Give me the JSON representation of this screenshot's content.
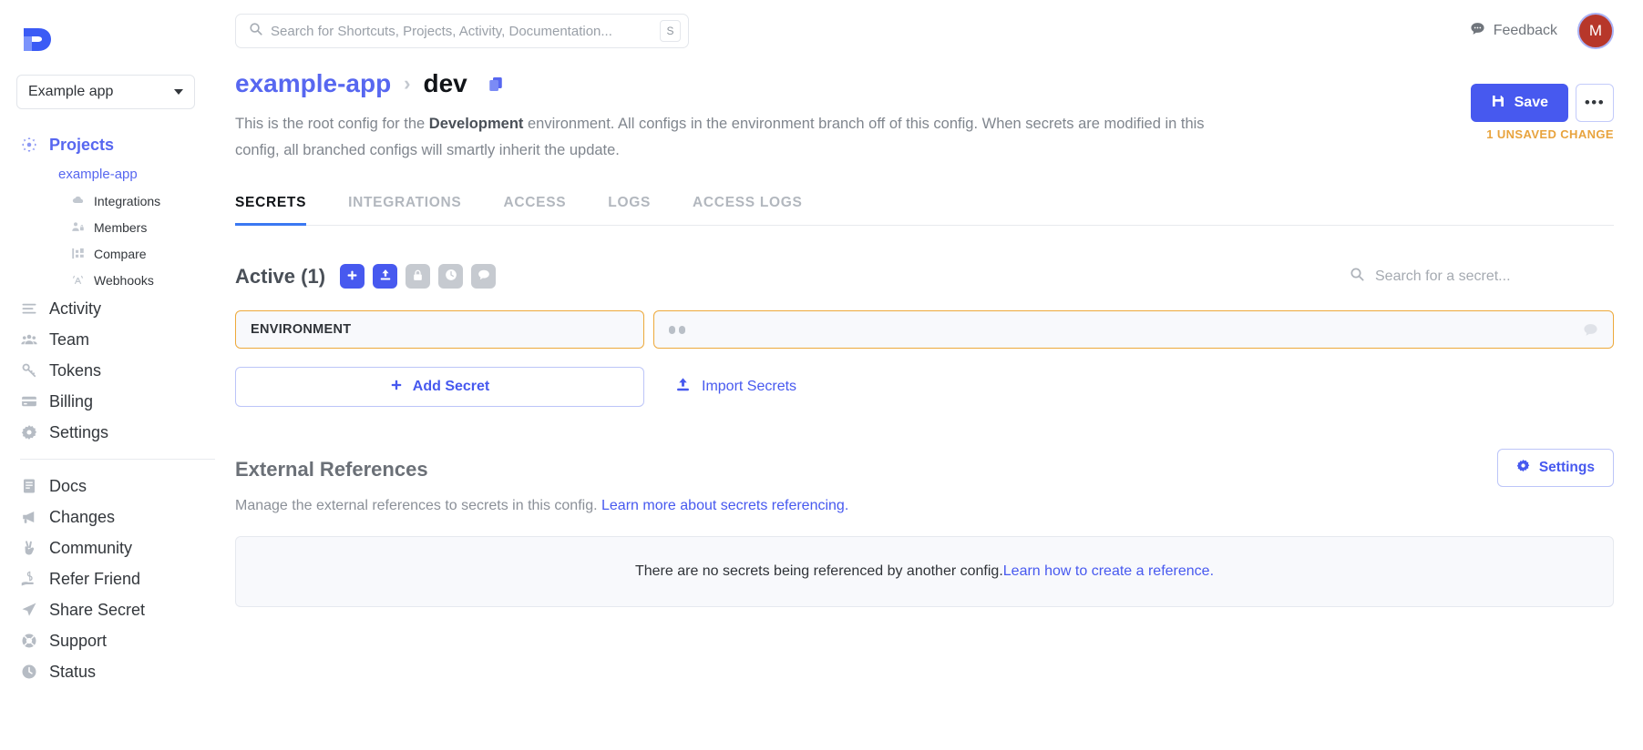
{
  "brand": {
    "logo_name": "doppler-logo",
    "accent": "#4759ef",
    "warning": "#e8a33d",
    "highlight": "#f01b1b"
  },
  "sidebar": {
    "app_selector": {
      "label": "Example app",
      "icon": "chevron-down-icon"
    },
    "projects": {
      "label": "Projects",
      "icon": "atom-icon"
    },
    "project_link": "example-app",
    "project_children": [
      {
        "label": "Integrations",
        "icon": "cloud-icon"
      },
      {
        "label": "Members",
        "icon": "members-lock-icon"
      },
      {
        "label": "Compare",
        "icon": "compare-icon"
      },
      {
        "label": "Webhooks",
        "icon": "webhook-icon"
      }
    ],
    "primary": [
      {
        "label": "Activity",
        "icon": "list-icon"
      },
      {
        "label": "Team",
        "icon": "people-icon"
      },
      {
        "label": "Tokens",
        "icon": "key-icon"
      },
      {
        "label": "Billing",
        "icon": "credit-card-icon"
      },
      {
        "label": "Settings",
        "icon": "gear-icon"
      }
    ],
    "secondary": [
      {
        "label": "Docs",
        "icon": "book-icon"
      },
      {
        "label": "Changes",
        "icon": "megaphone-icon"
      },
      {
        "label": "Community",
        "icon": "hand-peace-icon"
      },
      {
        "label": "Refer Friend",
        "icon": "hand-money-icon"
      },
      {
        "label": "Share Secret",
        "icon": "paper-plane-icon"
      },
      {
        "label": "Support",
        "icon": "lifebuoy-icon"
      },
      {
        "label": "Status",
        "icon": "clock-icon"
      }
    ]
  },
  "topbar": {
    "search_placeholder": "Search for Shortcuts, Projects, Activity, Documentation...",
    "search_icon": "search-icon",
    "search_shortcut": "S",
    "feedback_label": "Feedback",
    "feedback_icon": "comment-icon",
    "avatar_initial": "M"
  },
  "header": {
    "breadcrumb_project": "example-app",
    "breadcrumb_separator": "›",
    "breadcrumb_config": "dev",
    "copy_icon": "copy-icon",
    "description_prefix": "This is the root config for the ",
    "description_bold": "Development",
    "description_suffix": " environment. All configs in the environment branch off of this config. When secrets are modified in this config, all branched configs will smartly inherit the update.",
    "save_label": "Save",
    "save_icon": "floppy-disk-icon",
    "kebab_label": "•••",
    "unsaved_label": "1 UNSAVED CHANGE"
  },
  "tabs": [
    {
      "label": "SECRETS",
      "active": true
    },
    {
      "label": "INTEGRATIONS",
      "active": false
    },
    {
      "label": "ACCESS",
      "active": false
    },
    {
      "label": "LOGS",
      "active": false
    },
    {
      "label": "ACCESS LOGS",
      "active": false
    }
  ],
  "secrets": {
    "section_title": "Active (1)",
    "toolbar": [
      {
        "name": "add-secret-icon-button",
        "icon": "plus-icon",
        "style": "primary"
      },
      {
        "name": "import-secrets-icon-button",
        "icon": "upload-icon",
        "style": "primary"
      },
      {
        "name": "lock-icon-button",
        "icon": "lock-icon",
        "style": "muted"
      },
      {
        "name": "history-icon-button",
        "icon": "clock-icon",
        "style": "muted"
      },
      {
        "name": "notes-icon-button",
        "icon": "comment-icon",
        "style": "muted"
      }
    ],
    "search_placeholder": "Search for a secret...",
    "search_icon": "search-icon",
    "rows": [
      {
        "name": "ENVIRONMENT",
        "value_masked": "••",
        "note_icon": "comment-icon"
      }
    ],
    "add_secret_label": "Add Secret",
    "add_secret_icon": "plus-icon",
    "import_secrets_label": "Import Secrets",
    "import_secrets_icon": "upload-icon"
  },
  "external_references": {
    "title": "External References",
    "subtitle": "Manage the external references to secrets in this config. ",
    "subtitle_link": "Learn more about secrets referencing.",
    "settings_label": "Settings",
    "settings_icon": "gear-icon",
    "empty_text": "There are no secrets being referenced by another config. ",
    "empty_link": "Learn how to create a reference."
  }
}
